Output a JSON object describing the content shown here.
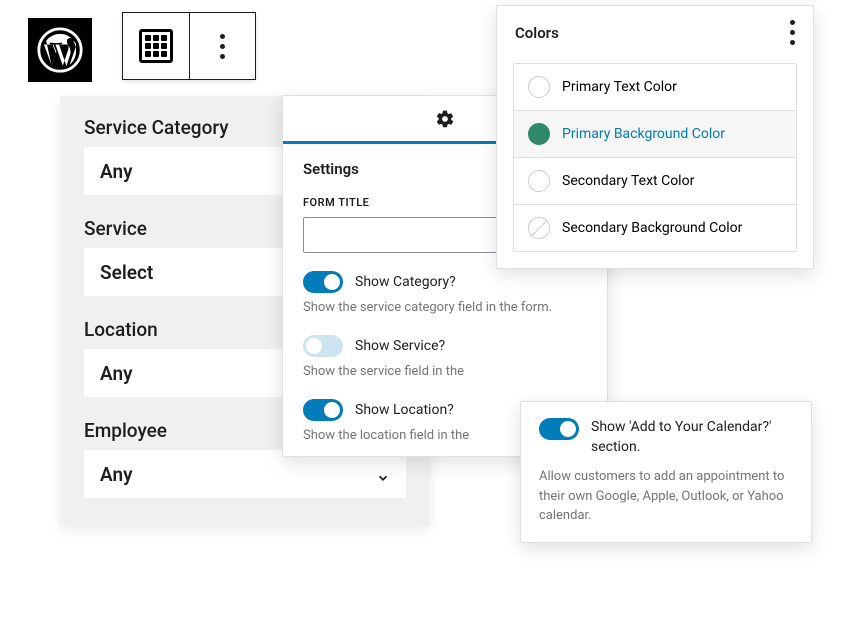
{
  "form": {
    "fields": [
      {
        "label": "Service Category",
        "value": "Any",
        "chevron": false
      },
      {
        "label": "Service",
        "value": "Select",
        "chevron": false
      },
      {
        "label": "Location",
        "value": "Any",
        "chevron": false
      },
      {
        "label": "Employee",
        "value": "Any",
        "chevron": true
      }
    ]
  },
  "settings": {
    "heading": "Settings",
    "form_title_label": "FORM TITLE",
    "form_title_value": "",
    "toggles": [
      {
        "label": "Show Category?",
        "on": true,
        "desc": "Show the service category field in the form."
      },
      {
        "label": "Show Service?",
        "on": false,
        "desc": "Show the service field in the"
      },
      {
        "label": "Show Location?",
        "on": true,
        "desc": "Show the location field in the"
      }
    ]
  },
  "colors": {
    "title": "Colors",
    "items": [
      {
        "label": "Primary Text Color",
        "swatch": "empty",
        "selected": false
      },
      {
        "label": "Primary Background Color",
        "swatch": "green",
        "selected": true
      },
      {
        "label": "Secondary Text Color",
        "swatch": "empty",
        "selected": false
      },
      {
        "label": "Secondary Background Color",
        "swatch": "slash",
        "selected": false
      }
    ]
  },
  "calendar": {
    "title": "Show 'Add to Your Calendar?' section.",
    "desc": "Allow customers to add an appointment to their own Google, Apple, Outlook, or Yahoo calendar."
  },
  "accent": "#007cba"
}
